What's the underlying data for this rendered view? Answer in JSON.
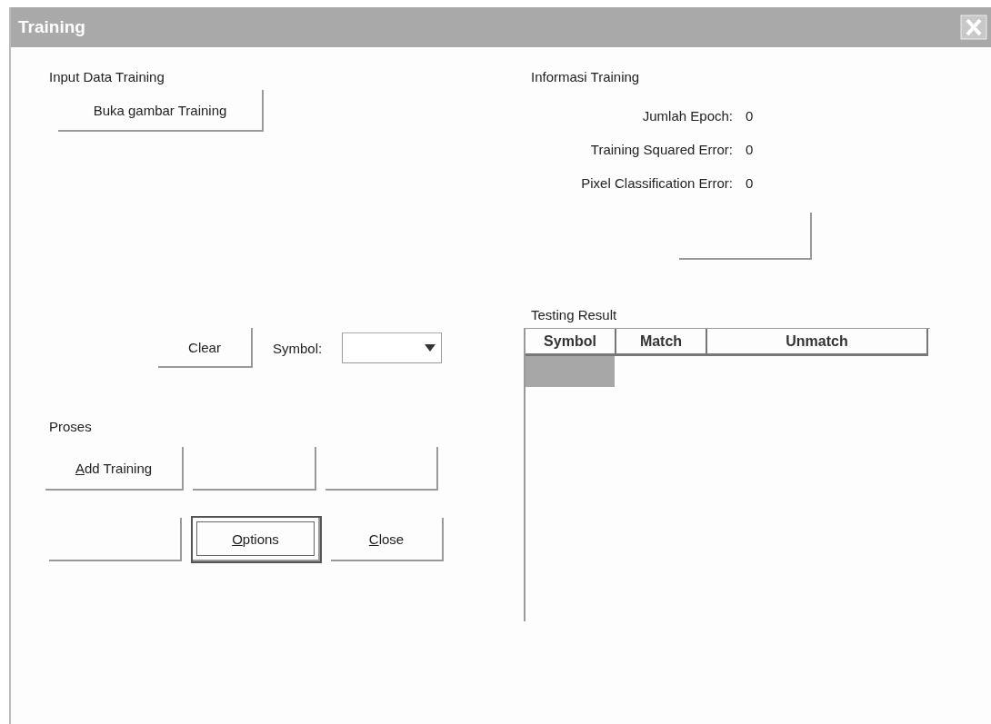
{
  "window": {
    "title": "Training"
  },
  "input_data": {
    "heading": "Input Data Training",
    "open_button": {
      "label": "Buka gambar Training"
    },
    "clear_button": {
      "label": "Clear"
    },
    "symbol_label": "Symbol:"
  },
  "proses": {
    "heading": "Proses",
    "buttons": [
      {
        "label": "Add Training",
        "underline_first": true,
        "focused": false
      },
      {
        "focused": false
      },
      {
        "focused": false
      },
      {
        "focused": false
      },
      {
        "label": "Options",
        "underline_first": true,
        "focused": true
      },
      {
        "label": "Close",
        "underline_first": true,
        "focused": false
      }
    ]
  },
  "informasi": {
    "heading": "Informasi Training",
    "rows": [
      {
        "label": "Jumlah  Epoch:",
        "value": "0"
      },
      {
        "label": "Training Squared Error:",
        "value": "0"
      },
      {
        "label": "Pixel Classification Error:",
        "value": "0"
      }
    ]
  },
  "testing": {
    "heading": "Testing Result",
    "columns": [
      "Symbol",
      "Match",
      "Unmatch"
    ],
    "first_cell_selected": true
  }
}
